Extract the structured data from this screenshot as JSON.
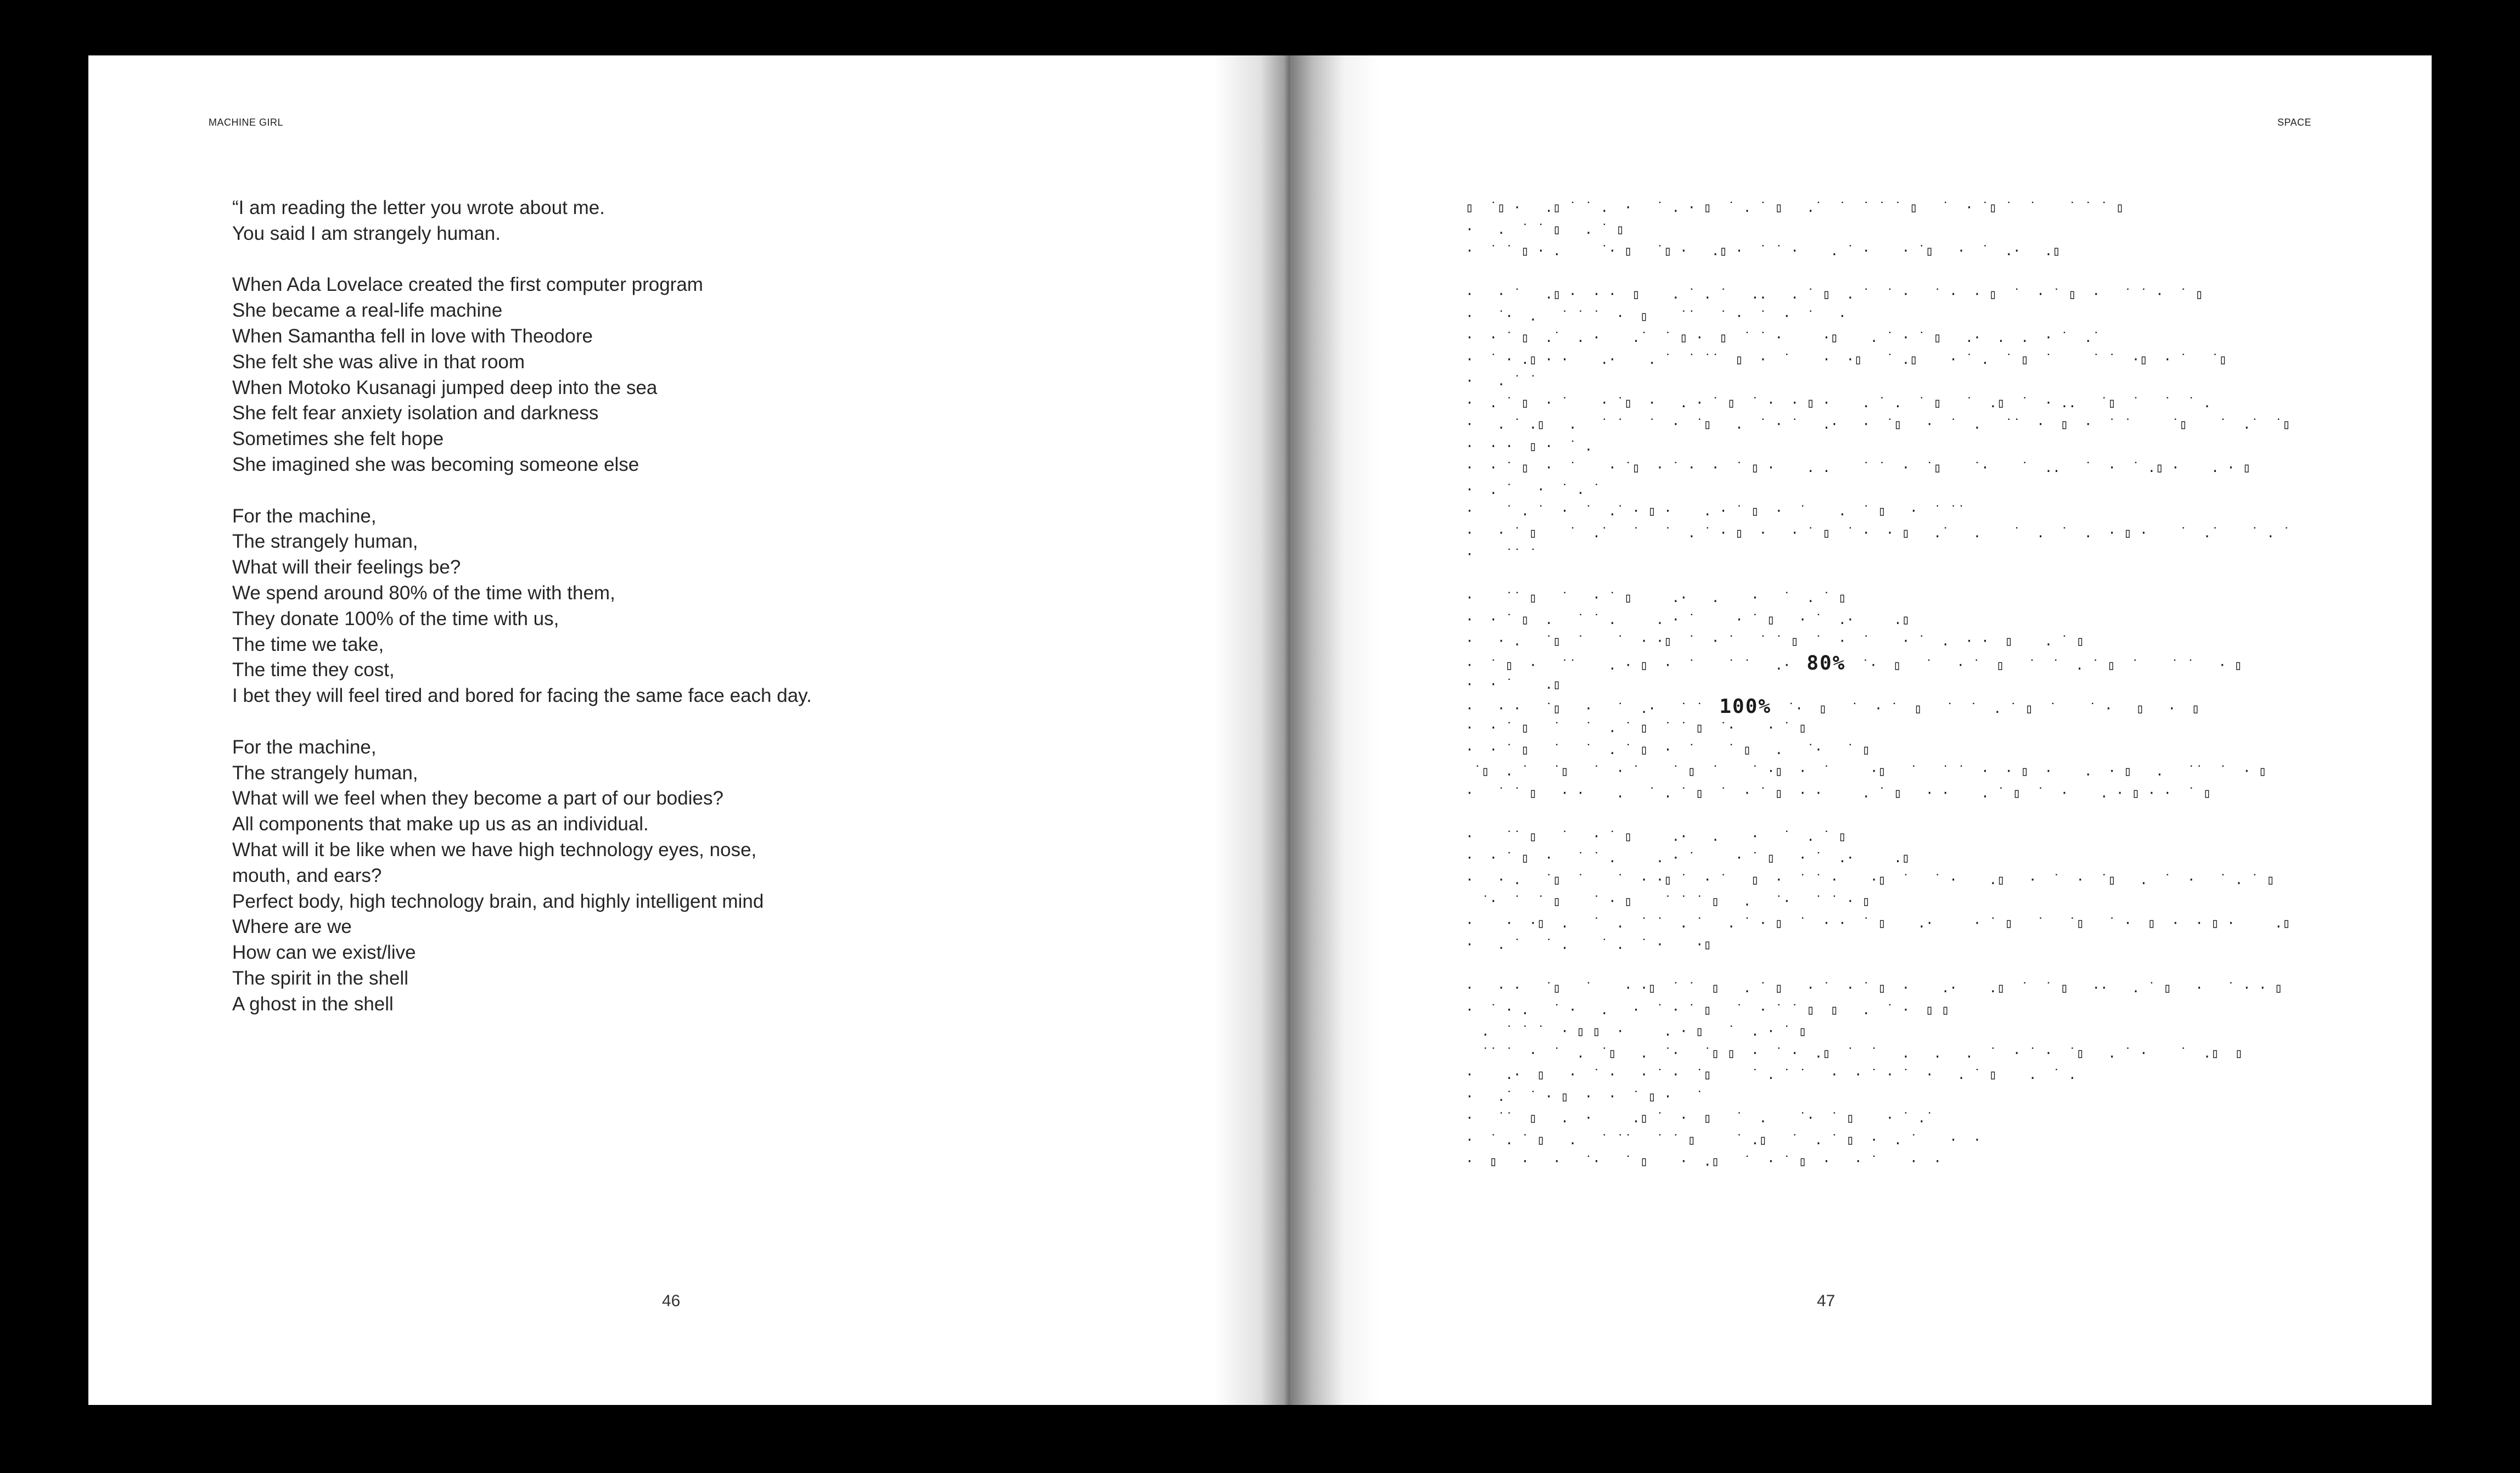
{
  "left_page": {
    "running_head": "MACHINE GIRL",
    "page_number": "46",
    "stanzas": [
      [
        "“I am reading the letter you wrote about me.",
        "You said I am strangely human."
      ],
      [
        "When Ada Lovelace created the first computer program",
        "She became a real-life machine",
        "When Samantha fell in love with Theodore",
        "She felt she was alive in that room",
        "When Motoko Kusanagi jumped deep into the sea",
        "She felt fear anxiety isolation and darkness",
        "Sometimes she felt hope",
        "She imagined she was becoming someone else"
      ],
      [
        "For the machine,",
        "The strangely human,",
        "What will their feelings be?",
        "We spend around 80% of the time with them,",
        "They donate 100% of the time with us,",
        "The time we take,",
        "The time they cost,",
        "I bet they will feel tired and bored for facing the same face each day."
      ],
      [
        "For the machine,",
        "The strangely human,",
        "What will we feel when they become a part of our bodies?",
        "All components that make up us as an individual.",
        "What will it be like when we have high technology eyes, nose,",
        "mouth, and ears?",
        "Perfect body, high technology brain, and highly intelligent mind",
        "Where are we",
        "How can we exist/live",
        "The spirit in the shell",
        "A ghost in the shell"
      ]
    ]
  },
  "right_page": {
    "running_head": "SPACE",
    "page_number": "47",
    "glyph_lines": [
      "▯  ˙▯ ·   .▯ ˙ ˙ .  ·   ˙ . · ▯  ˙ . ˙ ▯   .˙  ˙  ˙ ˙ ˙ ▯   ˙  · ˙▯ ˙  ˙    ˙ ˙ ˙ ▯",
      "·   .  ˙ ˙ ▯   . ˙ ▯",
      "·  ˙ ˙ ▯ · .     ˙· ▯   ˙▯ ·   .▯ ·  ˙ ˙ ·    . ˙ ·    · ˙▯   ·  ˙  .·   .▯",
      "",
      "·   · ˙   .▯ ·  · ·  ▯    . ˙ . ˙   ..   . ˙ ▯  . ˙  ˙ ·   ˙ ·  · ▯  ˙  · ˙ ▯  ·   ˙ ˙ ·  ˙ ▯",
      "·   ˙·  .   ˙ ˙ ˙  ·  ▯    ˙˙   ˙ ·  ˙  ·  ˙   ·",
      "·  · ˙ ▯  .˙  . ·    .˙  ˙ ▯ ·  ▯  ˙ ˙ ·     ·▯    . ˙ · ˙ ▯   .·  .  .  · ˙  .˙",
      "·  ˙ · .▯ · ·    .·    . ˙  ˙ ˙˙  ▯  ·  ˙    ·  ·▯   ˙ .▯    · ˙ .  ˙ ▯  ˙     ˙ ˙  ·▯  · ˙   ˙▯",
      "·   . ˙ ˙",
      "·  . ˙ ▯  · ˙    · ˙▯  ·   . · ˙ ▯  ˙ ·  · ▯ ·    . ˙ .  ˙ ▯   ˙  .▯  ˙  · ..   ˙▯  ˙   ˙  ˙ .",
      "·   . ˙ .▯   .   ˙ ˙   ˙  ·  ˙▯   .  ˙ · ˙   .·   ·  ˙▯   ·  ˙  .   ˙˙  ·  ▯  ·  ˙ ˙     ˙▯    ˙  .˙  ˙▯",
      "·  · ·  ▯ ·  ˙ .",
      "·  · ˙ ▯  ·  ˙    · ˙▯  · ˙ ·  ·  ˙ ▯ ·    . .    ˙ ˙  ·  ˙▯    ˙·    ˙  ..   ˙  ·  ˙ .▯ ·    . · ▯",
      "·  . ˙   ·  ˙ . ˙",
      "·    ˙ . ˙  ·  ˙  .˙ · ▯ ·    . · ˙ ▯  ·  ˙    .  ˙ ▯   ·  ˙ ˙˙",
      "·   · ˙ ▯    ˙  .˙   ˙   ˙  . ˙ · ▯  ·   · ˙ ▯  ˙ ·  · ▯   .˙   .    ˙  .  ˙  .  · ▯ ·    ˙  .˙    ˙ . ˙ ▯",
      "·    ˙˙ ˙",
      "",
      "·    ˙˙ ▯   ˙   · ˙ ▯     .·   .    ·   ˙  . ˙ ▯",
      "·  · ˙ ▯  .   ˙ ˙ .     . · ˙     · ˙ ▯   · ˙  .·     .▯",
      "·   · .   ˙▯  ˙    ˙  · ·▯  ˙  · ˙   ˙ ˙ ▯  ˙  ·  ˙    · ˙  .  · ·  ▯    . ˙ ▯",
      "·  ˙ ▯  ·   ˙˙    . · ▯  ·  ˙    ˙ ˙   .·  [[80]]  ˙·  ▯   ˙   · ˙  ▯   ˙  ˙  . ˙ ▯  ˙    ˙ ˙   · ▯",
      "·  · ˙    .▯",
      "·   · ·   ˙▯   ·   ˙  .·   ˙ ˙  [[100]]  ˙·  ▯   ˙  · ˙  ▯   ˙  ˙  . ˙ ▯  ˙    ˙ ·   ▯   ·  ▯",
      "·  · ˙ ▯   ˙   ˙  . ˙ ▯  ˙ ˙ ▯  ˙·    · ˙ ▯",
      "·  · ˙ ▯   ˙   ˙  . ˙ ▯  ·  ˙    ˙ ▯   .   ˙·   ˙ ▯",
      " ˙▯  . ˙   ˙▯   ˙  · ˙    ˙ ▯  ˙    ˙ ·▯  ·  ˙     ·▯   ˙   ˙ ˙  ·  · ▯  ·    .  · ▯   .   ˙˙  ˙  · ▯",
      "·   ˙ ˙ ▯   · ·    .   ˙ . ˙ ▯  ˙  · ˙ ▯  · ·     . ˙ ▯   · ·    . ˙ ▯  ˙  ·    . · ▯ · ·  ˙ ▯",
      "",
      "·    ˙˙ ▯   ˙   · ˙ ▯     .·   .    ·   ˙  . ˙ ▯",
      "·  · ˙ ▯  ·   ˙ ˙ .     . · ˙     · ˙ ▯   · ˙  .·     .▯",
      "·   · .   ˙▯  ˙    ˙  · ·▯ ˙  · ˙   ▯  ·  ˙ ˙ ·    ·▯  ˙   ˙ ·    .▯   ·  ˙  ·  ˙▯   .  ˙  ·   ˙ . ˙ ▯  ·  ▯",
      "  ˙·  ˙  ˙ ▯    ˙ · ▯    ˙ ˙ ˙ ▯   .   ˙·   ˙ ˙ · ▯",
      "·    ·  ·▯  .   ˙  .  ˙ ˙  . ˙   . ˙ · ▯  ˙  · ·  ˙ ▯    .·     · ˙ ▯   ˙   ˙▯   ˙ ·  ▯  ·  · ▯ ·     .▯",
      "·   . ˙   ˙ .    ˙ .  ˙ ·    ·▯",
      "",
      "·   · ·   ˙▯   ˙    · ·▯  ˙ ˙  ▯   . ˙ ▯   · ˙  · ˙ ▯  ·    .·    .▯  ˙  ˙ ▯   ··   . ˙ ▯   ·   ˙ · · ▯",
      "·  ˙ · .   ˙ ·   .   ·  ˙ · ˙ ▯   ˙  · ˙ ˙ ▯  ▯   .  ˙ ·  ▯ ▯",
      "  .  ˙ ˙ ˙  · ▯ ▯  ·     . · ▯   ˙  . · ˙ ▯",
      "  ˙˙ ˙  ·  ˙  .  ˙▯   .  ˙·   ˙▯ ▯  ·  ˙ ·  .▯  ˙  ˙   .   .   .  ˙  · ˙ ·  ˙▯   . ˙ ·    ˙  .▯  ▯",
      "·    .·  ▯   ·  ˙ ·   · ˙ ·  ˙▯     ˙ . ˙ ˙   ·  · ˙ · ˙  ·   . ˙ ▯    .  ˙ .",
      "·   .˙  ˙ · ▯  ·  ·  ˙ ▯ ·   ˙",
      "·   ˙˙  ▯   .  ·     .▯ ˙  ·  ▯   ˙  .    ˙·  ˙ ▯    · ˙ .˙",
      "·  ˙ . ˙ ▯   .   ˙ ˙˙   ˙ ˙ ▯     ˙ .▯   ˙  . ˙ ▯  ·  . ˙    ·  ·",
      "·  ▯   ·   ·   ˙·   ˙ ▯    ·  .▯   ˙  · ˙ ▯  ·   · ˙    ·  ·"
    ],
    "highlights": {
      "80": "80%",
      "100": "100%"
    }
  }
}
